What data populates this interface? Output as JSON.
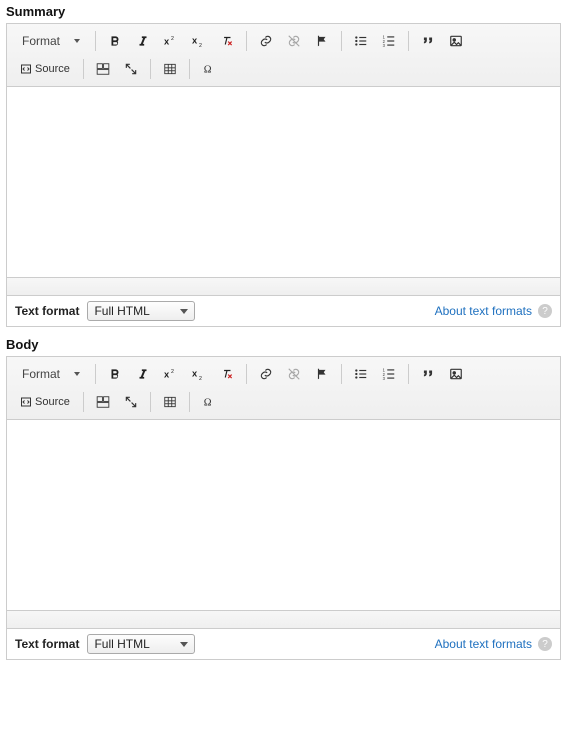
{
  "sections": {
    "summary": {
      "label": "Summary",
      "toolbar": {
        "format_label": "Format",
        "source_label": "Source"
      },
      "format_bar": {
        "label": "Text format",
        "selected": "Full HTML",
        "about_link": "About text formats"
      }
    },
    "body": {
      "label": "Body",
      "toolbar": {
        "format_label": "Format",
        "source_label": "Source"
      },
      "format_bar": {
        "label": "Text format",
        "selected": "Full HTML",
        "about_link": "About text formats"
      }
    }
  },
  "icons": {
    "help_q": "?"
  }
}
